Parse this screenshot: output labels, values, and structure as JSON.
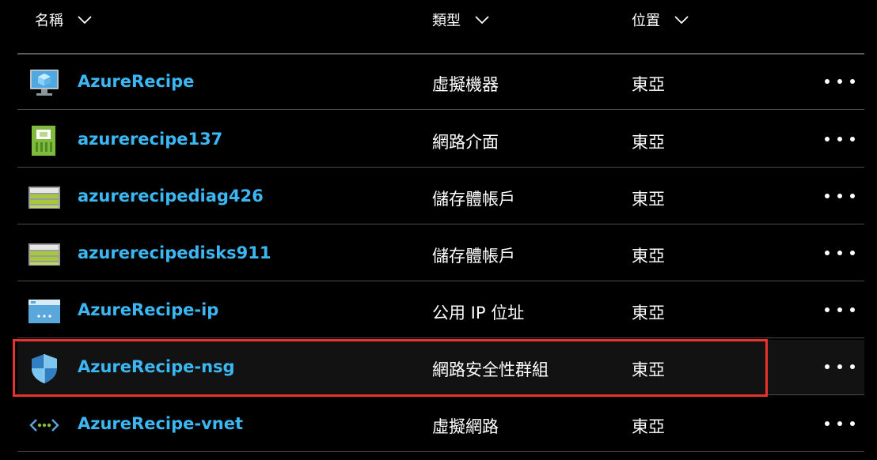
{
  "header": {
    "col_name": "名稱",
    "col_type": "類型",
    "col_location": "位置"
  },
  "rows": [
    {
      "name": "AzureRecipe",
      "type": "虛擬機器",
      "location": "東亞",
      "icon": "virtual-machine-icon"
    },
    {
      "name": "azurerecipe137",
      "type": "網路介面",
      "location": "東亞",
      "icon": "network-interface-icon"
    },
    {
      "name": "azurerecipediag426",
      "type": "儲存體帳戶",
      "location": "東亞",
      "icon": "storage-account-icon"
    },
    {
      "name": "azurerecipedisks911",
      "type": "儲存體帳戶",
      "location": "東亞",
      "icon": "storage-account-icon"
    },
    {
      "name": "AzureRecipe-ip",
      "type": "公用 IP 位址",
      "location": "東亞",
      "icon": "public-ip-icon"
    },
    {
      "name": "AzureRecipe-nsg",
      "type": "網路安全性群組",
      "location": "東亞",
      "icon": "network-security-group-icon",
      "selected": true
    },
    {
      "name": "AzureRecipe-vnet",
      "type": "虛擬網路",
      "location": "東亞",
      "icon": "virtual-network-icon"
    }
  ],
  "colors": {
    "link": "#3bb8f3",
    "highlight_border": "#e8322c",
    "background": "#000000"
  }
}
